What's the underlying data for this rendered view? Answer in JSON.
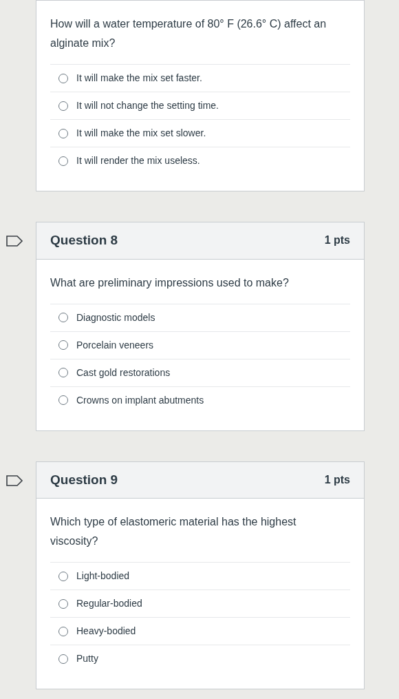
{
  "questions": [
    {
      "prompt": "How will a water temperature of 80° F (26.6° C) affect an alginate mix?",
      "options": [
        {
          "label": "It will make the mix set faster.",
          "selected": false
        },
        {
          "label": "It will not change the setting time.",
          "selected": false
        },
        {
          "label": "It will make the mix set slower.",
          "selected": false
        },
        {
          "label": "It will render the mix useless.",
          "selected": false
        }
      ]
    },
    {
      "title": "Question 8",
      "points": "1 pts",
      "prompt": "What are preliminary impressions used to make?",
      "options": [
        {
          "label": "Diagnostic models",
          "selected": false
        },
        {
          "label": "Porcelain veneers",
          "selected": false
        },
        {
          "label": "Cast gold restorations",
          "selected": false
        },
        {
          "label": "Crowns on implant abutments",
          "selected": false
        }
      ]
    },
    {
      "title": "Question 9",
      "points": "1 pts",
      "prompt": "Which type of elastomeric material has the highest viscosity?",
      "options": [
        {
          "label": "Light-bodied",
          "selected": false
        },
        {
          "label": "Regular-bodied",
          "selected": false
        },
        {
          "label": "Heavy-bodied",
          "selected": false
        },
        {
          "label": "Putty",
          "selected": false
        }
      ]
    }
  ]
}
